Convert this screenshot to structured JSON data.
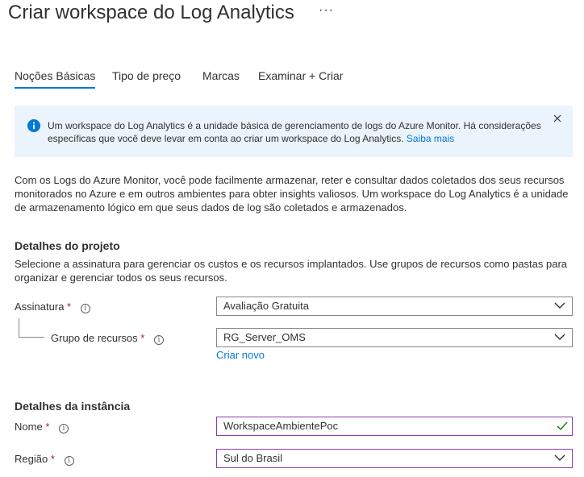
{
  "page": {
    "title": "Criar workspace do Log Analytics",
    "more_label": "···"
  },
  "tabs": [
    {
      "label": "Noções Básicas",
      "active": true
    },
    {
      "label": "Tipo de preço",
      "active": false
    },
    {
      "label": "Marcas",
      "active": false
    },
    {
      "label": "Examinar + Criar",
      "active": false
    }
  ],
  "info": {
    "text": "Um workspace do Log Analytics é a unidade básica de gerenciamento de logs do Azure Monitor. Há considerações específicas que você deve levar em conta ao criar um workspace do Log Analytics.",
    "link": "Saiba mais"
  },
  "intro": "Com os Logs do Azure Monitor, você pode facilmente armazenar, reter e consultar dados coletados dos seus recursos monitorados no Azure e em outros ambientes para obter insights valiosos. Um workspace do Log Analytics é a unidade de armazenamento lógico em que seus dados de log são coletados e armazenados.",
  "project": {
    "title": "Detalhes do projeto",
    "description": "Selecione a assinatura para gerenciar os custos e os recursos implantados. Use grupos de recursos como pastas para organizar e gerenciar todos os seus recursos.",
    "subscription": {
      "label": "Assinatura",
      "required": "*",
      "value": "Avaliação Gratuita"
    },
    "resource_group": {
      "label": "Grupo de recursos",
      "required": "*",
      "value": "RG_Server_OMS",
      "create_new": "Criar novo"
    }
  },
  "instance": {
    "title": "Detalhes da instância",
    "name": {
      "label": "Nome",
      "required": "*",
      "value": "WorkspaceAmbientePoc"
    },
    "region": {
      "label": "Região",
      "required": "*",
      "value": "Sul do Brasil"
    }
  },
  "colors": {
    "accent": "#0078d4",
    "info_bg": "#ebf3fc",
    "required": "#a4262c",
    "valid": "#107c10",
    "focus_border": "#8a3ab9"
  },
  "icons": {
    "info": "info-circle-icon",
    "close": "close-icon",
    "help": "info-help-icon",
    "chevron": "chevron-down-icon",
    "check": "checkmark-icon"
  }
}
